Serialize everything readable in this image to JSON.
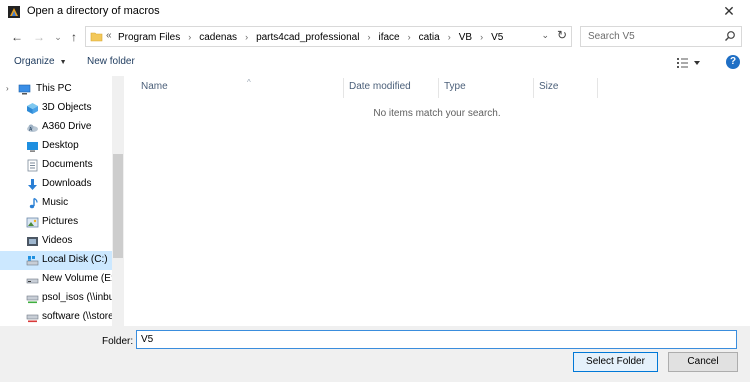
{
  "window": {
    "title": "Open a directory of macros",
    "close_glyph": "✕"
  },
  "nav": {
    "back_glyph": "←",
    "forward_glyph": "→",
    "recent_glyph": "⌄",
    "up_glyph": "↑"
  },
  "address": {
    "overflow_glyph": "«",
    "crumbs": [
      "Program Files",
      "cadenas",
      "parts4cad_professional",
      "iface",
      "catia",
      "VB",
      "V5"
    ],
    "separator": "›",
    "dropdown_glyph": "⌄",
    "refresh_glyph": "↻"
  },
  "search": {
    "placeholder": "Search V5"
  },
  "toolbar": {
    "organize_label": "Organize",
    "organize_caret": "▼",
    "new_folder_label": "New folder",
    "help_label": "?"
  },
  "sidebar": {
    "root_chevron": "›",
    "items": [
      {
        "label": "This PC",
        "icon": "pc-icon",
        "root": true
      },
      {
        "label": "3D Objects",
        "icon": "3d-objects-icon"
      },
      {
        "label": "A360 Drive",
        "icon": "cloud-drive-icon"
      },
      {
        "label": "Desktop",
        "icon": "desktop-icon"
      },
      {
        "label": "Documents",
        "icon": "documents-icon"
      },
      {
        "label": "Downloads",
        "icon": "downloads-icon"
      },
      {
        "label": "Music",
        "icon": "music-icon"
      },
      {
        "label": "Pictures",
        "icon": "pictures-icon"
      },
      {
        "label": "Videos",
        "icon": "videos-icon"
      },
      {
        "label": "Local Disk (C:)",
        "icon": "local-disk-icon",
        "selected": true
      },
      {
        "label": "New Volume (E:)",
        "icon": "drive-icon"
      },
      {
        "label": "psol_isos (\\\\inbu",
        "icon": "network-drive-icon"
      },
      {
        "label": "software (\\\\store",
        "icon": "network-drive-icon"
      }
    ]
  },
  "columns": {
    "name": "Name",
    "date_modified": "Date modified",
    "type": "Type",
    "size": "Size",
    "sort_glyph": "^"
  },
  "main": {
    "empty_message": "No items match your search."
  },
  "footer": {
    "folder_label": "Folder:",
    "folder_value": "V5",
    "select_button": "Select Folder",
    "cancel_button": "Cancel"
  },
  "colors": {
    "accent": "#0078d7",
    "selection": "#cce8ff",
    "help": "#1f6fc5"
  }
}
